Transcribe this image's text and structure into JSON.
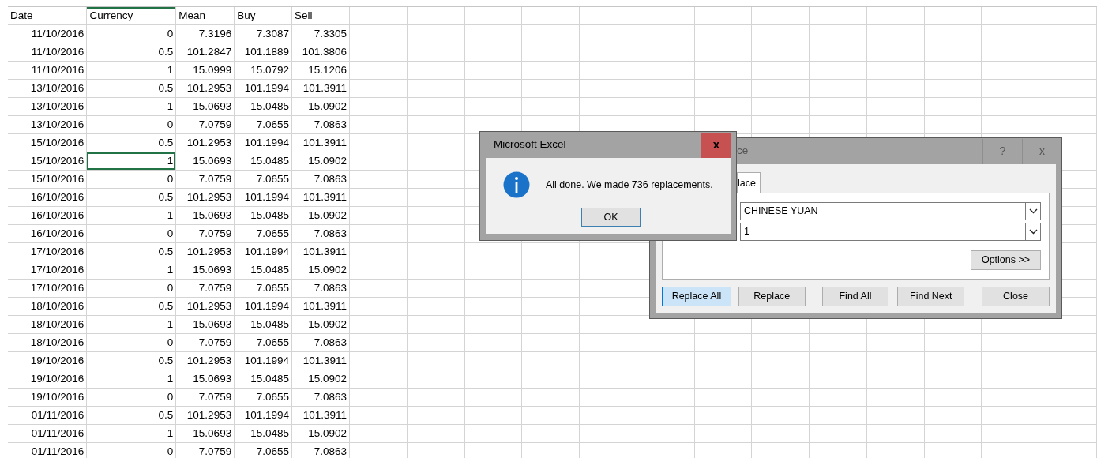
{
  "sheet": {
    "columns": [
      "Date",
      "Currency",
      "Mean",
      "Buy",
      "Sell"
    ],
    "rows": [
      {
        "cells": [
          "11/10/2016",
          "0",
          "7.3196",
          "7.3087",
          "7.3305"
        ],
        "selected": false
      },
      {
        "cells": [
          "11/10/2016",
          "0.5",
          "101.2847",
          "101.1889",
          "101.3806"
        ],
        "selected": false
      },
      {
        "cells": [
          "11/10/2016",
          "1",
          "15.0999",
          "15.0792",
          "15.1206"
        ],
        "selected": false
      },
      {
        "cells": [
          "13/10/2016",
          "0.5",
          "101.2953",
          "101.1994",
          "101.3911"
        ],
        "selected": false
      },
      {
        "cells": [
          "13/10/2016",
          "1",
          "15.0693",
          "15.0485",
          "15.0902"
        ],
        "selected": false
      },
      {
        "cells": [
          "13/10/2016",
          "0",
          "7.0759",
          "7.0655",
          "7.0863"
        ],
        "selected": false
      },
      {
        "cells": [
          "15/10/2016",
          "0.5",
          "101.2953",
          "101.1994",
          "101.3911"
        ],
        "selected": false
      },
      {
        "cells": [
          "15/10/2016",
          "1",
          "15.0693",
          "15.0485",
          "15.0902"
        ],
        "selected": true
      },
      {
        "cells": [
          "15/10/2016",
          "0",
          "7.0759",
          "7.0655",
          "7.0863"
        ],
        "selected": false
      },
      {
        "cells": [
          "16/10/2016",
          "0.5",
          "101.2953",
          "101.1994",
          "101.3911"
        ],
        "selected": false
      },
      {
        "cells": [
          "16/10/2016",
          "1",
          "15.0693",
          "15.0485",
          "15.0902"
        ],
        "selected": false
      },
      {
        "cells": [
          "16/10/2016",
          "0",
          "7.0759",
          "7.0655",
          "7.0863"
        ],
        "selected": false
      },
      {
        "cells": [
          "17/10/2016",
          "0.5",
          "101.2953",
          "101.1994",
          "101.3911"
        ],
        "selected": false
      },
      {
        "cells": [
          "17/10/2016",
          "1",
          "15.0693",
          "15.0485",
          "15.0902"
        ],
        "selected": false
      },
      {
        "cells": [
          "17/10/2016",
          "0",
          "7.0759",
          "7.0655",
          "7.0863"
        ],
        "selected": false
      },
      {
        "cells": [
          "18/10/2016",
          "0.5",
          "101.2953",
          "101.1994",
          "101.3911"
        ],
        "selected": false
      },
      {
        "cells": [
          "18/10/2016",
          "1",
          "15.0693",
          "15.0485",
          "15.0902"
        ],
        "selected": false
      },
      {
        "cells": [
          "18/10/2016",
          "0",
          "7.0759",
          "7.0655",
          "7.0863"
        ],
        "selected": false
      },
      {
        "cells": [
          "19/10/2016",
          "0.5",
          "101.2953",
          "101.1994",
          "101.3911"
        ],
        "selected": false
      },
      {
        "cells": [
          "19/10/2016",
          "1",
          "15.0693",
          "15.0485",
          "15.0902"
        ],
        "selected": false
      },
      {
        "cells": [
          "19/10/2016",
          "0",
          "7.0759",
          "7.0655",
          "7.0863"
        ],
        "selected": false
      },
      {
        "cells": [
          "01/11/2016",
          "0.5",
          "101.2953",
          "101.1994",
          "101.3911"
        ],
        "selected": false
      },
      {
        "cells": [
          "01/11/2016",
          "1",
          "15.0693",
          "15.0485",
          "15.0902"
        ],
        "selected": false
      },
      {
        "cells": [
          "01/11/2016",
          "0",
          "7.0759",
          "7.0655",
          "7.0863"
        ],
        "selected": false
      }
    ]
  },
  "message_box": {
    "title": "Microsoft Excel",
    "close_glyph": "x",
    "message": "All done. We made 736 replacements.",
    "button": "OK"
  },
  "find_replace_dialog": {
    "title": "ce",
    "title_buttons": [
      "?",
      "x"
    ],
    "tabs": [
      {
        "label": "lace",
        "selected": true
      }
    ],
    "find_what": "CHINESE YUAN",
    "replace_with": "1",
    "options_button": "Options >>",
    "buttons": [
      {
        "label": "Replace All",
        "default": true
      },
      {
        "label": "Replace",
        "default": false
      },
      {
        "label": "Find All",
        "default": false
      },
      {
        "label": "Find Next",
        "default": false
      },
      {
        "label": "Close",
        "default": false
      }
    ]
  }
}
